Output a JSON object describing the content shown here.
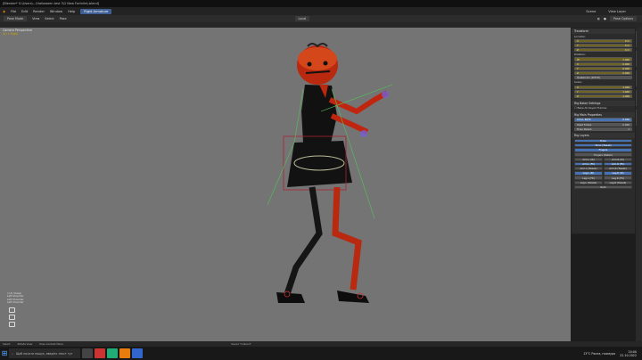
{
  "titlebar": {
    "title": "[Blender* G:\\Users\\...\\Halloween test 3\\2 New Fortnite\\.blend]"
  },
  "menubar": {
    "items": [
      "File",
      "Edit",
      "Render",
      "Window",
      "Help"
    ],
    "active_tab": "Rigid Armature",
    "scene": "Scene",
    "view_layer": "View Layer"
  },
  "toolbar": {
    "mode": "Pose Mode",
    "items": [
      "View",
      "Select",
      "Pose"
    ],
    "transform": "Local",
    "pose_options": "Pose Options"
  },
  "viewport": {
    "camera_label": "Camera Perspective",
    "object_label": "(0) 1 Rigid",
    "log": [
      "(>4) Sheep",
      "Left Shoulder",
      "Left Shoulder",
      "Left Shoulder"
    ]
  },
  "npanel": {
    "transform_title": "Transform",
    "location_label": "Location:",
    "location": [
      {
        "axis": "X",
        "value": "0 m"
      },
      {
        "axis": "Y",
        "value": "0 m"
      },
      {
        "axis": "Z",
        "value": "0 m"
      }
    ],
    "rotation_label": "Rotation:",
    "rotation": [
      {
        "axis": "W",
        "value": "1.000"
      },
      {
        "axis": "X",
        "value": "0.000"
      },
      {
        "axis": "Y",
        "value": "0.000"
      },
      {
        "axis": "Z",
        "value": "0.000"
      }
    ],
    "rotation_mode": "Quaternion (WXYZ)",
    "scale_label": "Scale:",
    "scale": [
      {
        "axis": "X",
        "value": "1.000"
      },
      {
        "axis": "Y",
        "value": "1.000"
      },
      {
        "axis": "Z",
        "value": "1.000"
      }
    ],
    "rig_baker_title": "Rig Baker Settings",
    "rig_baker_option": "Bake All Keyed Frames",
    "rig_main_title": "Rig Main Properties",
    "rig_main": [
      {
        "label": "Arm.L IK/FK",
        "value": "0.000"
      },
      {
        "label": "Head Follow",
        "value": "0.000"
      },
      {
        "label": "Torso Parent",
        "value": "1"
      }
    ],
    "rig_layers_title": "Rig Layers",
    "layers": [
      [
        {
          "label": "Torso",
          "on": true
        }
      ],
      [
        {
          "label": "Torso (Tweak)",
          "on": true
        }
      ],
      [
        {
          "label": "Fingers",
          "on": true
        }
      ],
      [
        {
          "label": "Fingers (Detail)",
          "on": false
        }
      ],
      [
        {
          "label": "Arm.L (IK)",
          "on": false
        },
        {
          "label": "Arm.R (IK)",
          "on": false
        }
      ],
      [
        {
          "label": "Arm.L (FK)",
          "on": true
        },
        {
          "label": "Arm.R (FK)",
          "on": true
        }
      ],
      [
        {
          "label": "Arm.L (Tweak)",
          "on": false
        },
        {
          "label": "Arm.R (Tweak)",
          "on": false
        }
      ],
      [
        {
          "label": "Leg.L (IK)",
          "on": true
        },
        {
          "label": "Leg.R (IK)",
          "on": true
        }
      ],
      [
        {
          "label": "Leg.L (FK)",
          "on": false
        },
        {
          "label": "Leg.R (FK)",
          "on": false
        }
      ],
      [
        {
          "label": "Leg.L (Tweak)",
          "on": false
        },
        {
          "label": "Leg.R (Tweak)",
          "on": false
        }
      ],
      [
        {
          "label": "Root",
          "on": false
        }
      ]
    ]
  },
  "statusbar": {
    "items": [
      "Select",
      "Rotate View",
      "Pose Context Menu"
    ],
    "saved": "Saved \"4.blend\""
  },
  "taskbar": {
    "search_placeholder": "Щоб почати пошук, введіть текст тут",
    "weather": "13°C  Рясна, похмуро",
    "time": "20:00",
    "date": "22.10.2022"
  },
  "colors": {
    "viewport_bg": "#747474",
    "accent": "#4772b3",
    "field_gold": "#6f6324"
  }
}
